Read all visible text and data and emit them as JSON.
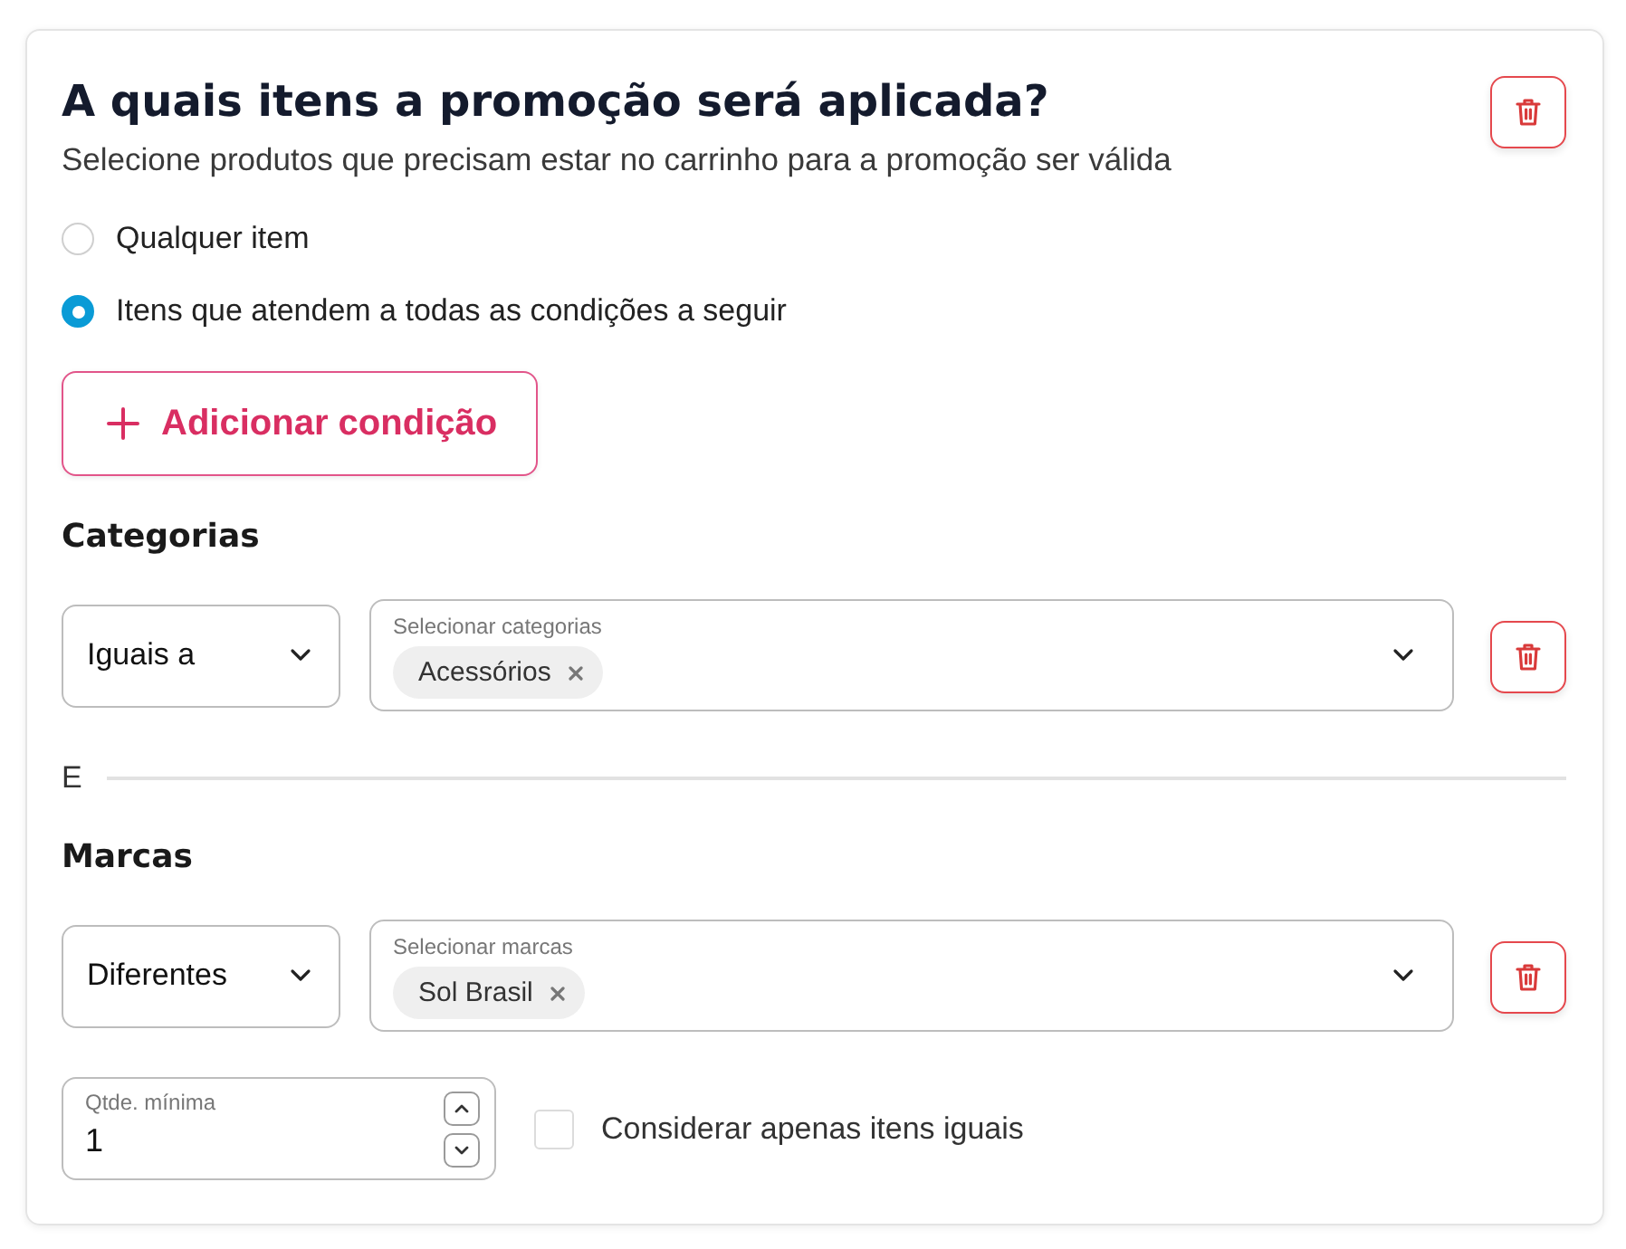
{
  "title": "A quais itens a promoção será aplicada?",
  "subtitle": "Selecione produtos que precisam estar no carrinho para a promoção ser válida",
  "options": [
    {
      "label": "Qualquer item",
      "selected": false
    },
    {
      "label": "Itens que atendem a todas as condições a seguir",
      "selected": true
    }
  ],
  "add_button": {
    "label": "Adicionar condição"
  },
  "conditions": [
    {
      "heading": "Categorias",
      "operator": "Iguais a",
      "field_label": "Selecionar categorias",
      "tags": [
        "Acessórios"
      ]
    },
    {
      "heading": "Marcas",
      "operator": "Diferentes",
      "field_label": "Selecionar marcas",
      "tags": [
        "Sol Brasil"
      ]
    }
  ],
  "connector": "E",
  "min_quantity": {
    "label": "Qtde. mínima",
    "value": "1"
  },
  "same_items": {
    "label": "Considerar apenas itens iguais",
    "checked": false
  }
}
